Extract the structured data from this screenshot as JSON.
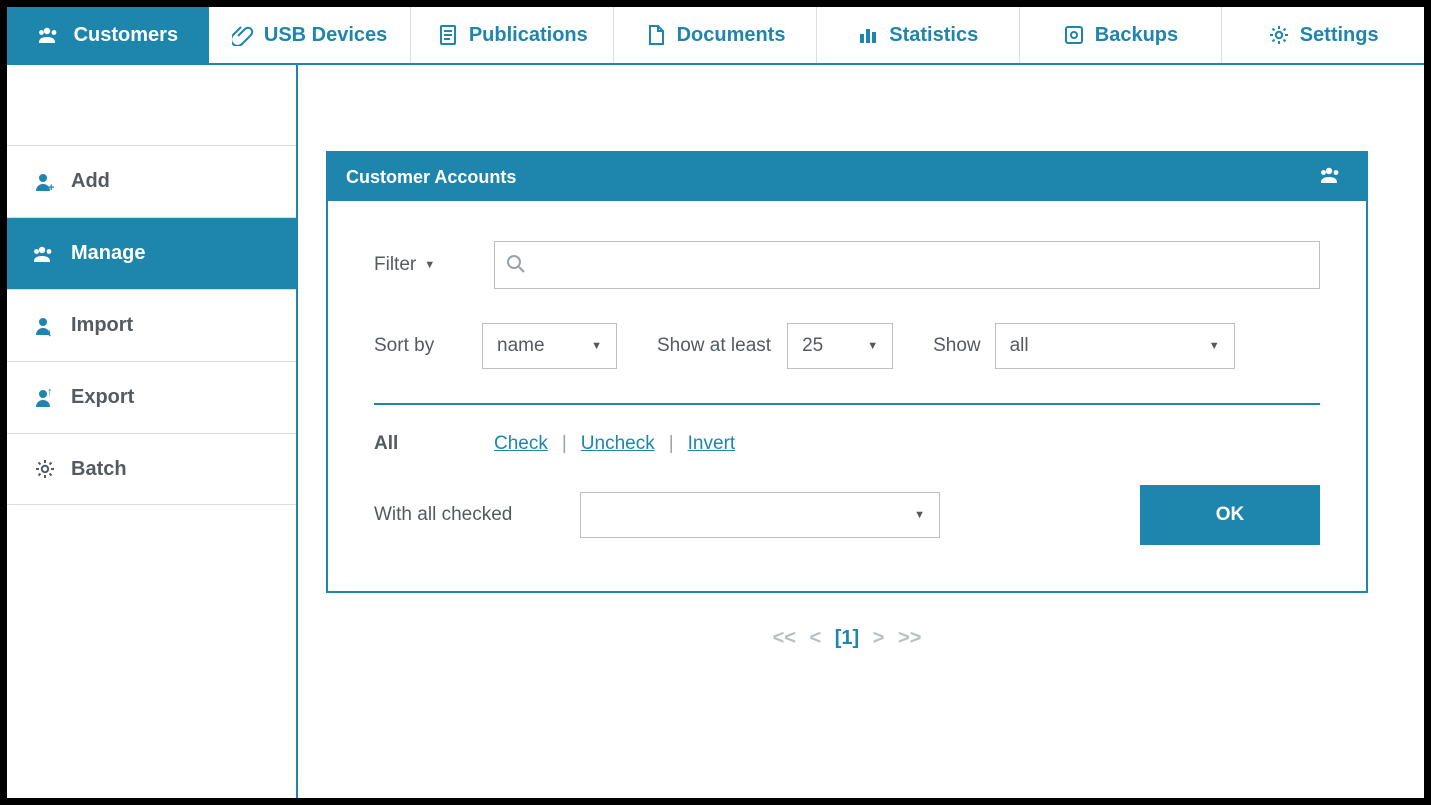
{
  "colors": {
    "primary": "#1e86ad",
    "text": "#555a60",
    "muted": "#b9bfc3"
  },
  "tabs": [
    {
      "label": "Customers",
      "icon": "group-icon",
      "active": true
    },
    {
      "label": "USB Devices",
      "icon": "paperclip-icon",
      "active": false
    },
    {
      "label": "Publications",
      "icon": "doc-list-icon",
      "active": false
    },
    {
      "label": "Documents",
      "icon": "page-icon",
      "active": false
    },
    {
      "label": "Statistics",
      "icon": "bar-chart-icon",
      "active": false
    },
    {
      "label": "Backups",
      "icon": "disk-icon",
      "active": false
    },
    {
      "label": "Settings",
      "icon": "gear-icon",
      "active": false
    }
  ],
  "sidebar": {
    "items": [
      {
        "label": "Add",
        "icon": "user-add-icon",
        "active": false
      },
      {
        "label": "Manage",
        "icon": "group-icon",
        "active": true
      },
      {
        "label": "Import",
        "icon": "user-import-icon",
        "active": false
      },
      {
        "label": "Export",
        "icon": "user-export-icon",
        "active": false
      },
      {
        "label": "Batch",
        "icon": "gear-icon",
        "active": false
      }
    ]
  },
  "panel": {
    "title": "Customer Accounts",
    "filter": {
      "label": "Filter",
      "value": ""
    },
    "sort": {
      "label": "Sort by",
      "value": "name"
    },
    "show_at_least": {
      "label": "Show at least",
      "value": "25"
    },
    "show": {
      "label": "Show",
      "value": "all"
    },
    "select_all_label": "All",
    "links": {
      "check": "Check",
      "uncheck": "Uncheck",
      "invert": "Invert"
    },
    "with_checked_label": "With all checked",
    "with_checked_value": "",
    "ok_label": "OK"
  },
  "pager": {
    "first": "<<",
    "prev": "<",
    "current": "[1]",
    "next": ">",
    "last": ">>"
  }
}
